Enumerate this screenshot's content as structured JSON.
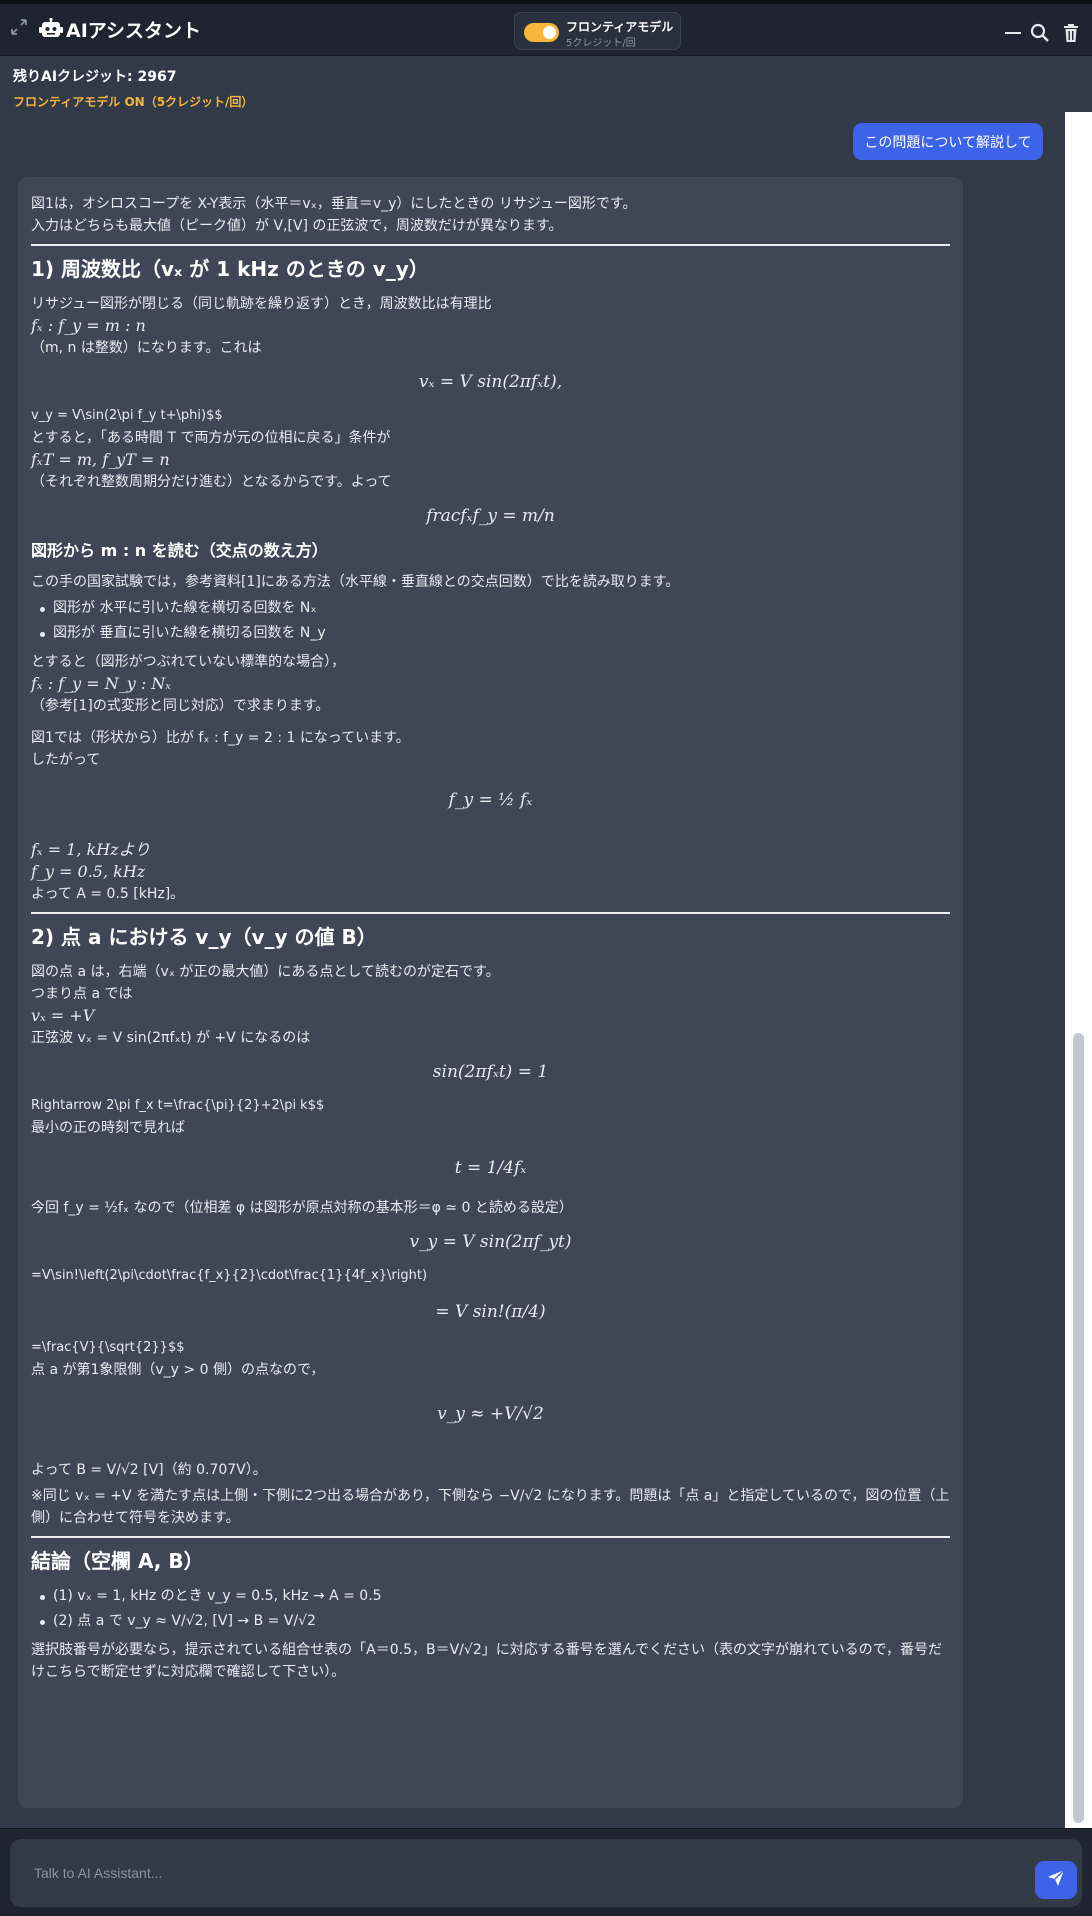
{
  "header": {
    "title": "AIアシスタント",
    "model_toggle": {
      "title": "フロンティアモデル",
      "subtitle": "5クレジット/回",
      "enabled": true,
      "accent": "#f5b63a"
    },
    "icons": [
      "expand-icon",
      "robot-icon",
      "minimize-icon",
      "search-icon",
      "trash-icon"
    ]
  },
  "status": {
    "credits": "残りAIクレジット: 2967",
    "frontier": "フロンティアモデル ON（5クレジット/回）"
  },
  "user_message": "この問題について解説して",
  "answer": {
    "intro1": "図1は，オシロスコープを X-Y表示（水平＝vₓ，垂直＝v_y）にしたときの リサジュー図形です。",
    "intro2": "入力はどちらも最大値（ピーク値）が V,[V] の正弦波で，周波数だけが異なります。",
    "s1_heading": "1) 周波数比（vₓ が 1 kHz のときの v_y）",
    "s1_l1": "リサジュー図形が閉じる（同じ軌跡を繰り返す）とき，周波数比は有理比",
    "s1_f1": "fₓ : f_y = m : n",
    "s1_l2": "（m, n は整数）になります。これは",
    "s1_d1": "vₓ = V sin(2πfₓt),",
    "s1_raw1": "v_y = V\\sin(2\\pi f_y t+\\phi)$$",
    "s1_l3": "とすると，「ある時間 T で両方が元の位相に戻る」条件が",
    "s1_f2": "fₓT = m,    f_yT = n",
    "s1_l4": "（それぞれ整数周期分だけ進む）となるからです。よって",
    "s1_d2": "fracfₓf_y = m/n",
    "s1_sub_heading": "図形から m : n を読む（交点の数え方）",
    "s1_l5": "この手の国家試験では，参考資料[1]にある方法（水平線・垂直線との交点回数）で比を読み取ります。",
    "s1_b1": "図形が 水平に引いた線を横切る回数を Nₓ",
    "s1_b2": "図形が 垂直に引いた線を横切る回数を N_y",
    "s1_l6": "とすると（図形がつぶれていない標準的な場合），",
    "s1_f3": "fₓ : f_y = N_y : Nₓ",
    "s1_l7": "（参考[1]の式変形と同じ対応）で求まります。",
    "s1_l8": "図1では（形状から）比が fₓ : f_y = 2 : 1 になっています。",
    "s1_l9": "したがって",
    "s1_d3": "f_y = ½ fₓ",
    "s1_f4": "fₓ = 1, kHzより",
    "s1_f5": "f_y = 0.5, kHz",
    "s1_result": "よって A = 0.5 [kHz]。",
    "s2_heading": "2) 点 a における v_y（v_y の値 B）",
    "s2_l1": "図の点 a は，右端（vₓ が正の最大値）にある点として読むのが定石です。",
    "s2_l2": "つまり点 a では",
    "s2_f1": "vₓ = +V",
    "s2_l3": "正弦波 vₓ = V sin(2πfₓt) が +V になるのは",
    "s2_d1": "sin(2πfₓt) = 1",
    "s2_raw1": "Rightarrow 2\\pi f_x t=\\frac{\\pi}{2}+2\\pi k$$",
    "s2_l4": "最小の正の時刻で見れば",
    "s2_d2": "t = 1/4fₓ",
    "s2_l5": "今回 f_y = ½fₓ なので（位相差 φ は図形が原点対称の基本形＝φ ≃ 0 と読める設定）",
    "s2_d3": "v_y = V sin(2πf_yt)",
    "s2_raw2": "=V\\sin!\\left(2\\pi\\cdot\\frac{f_x}{2}\\cdot\\frac{1}{4f_x}\\right)",
    "s2_d4": "= V sin!(π/4)",
    "s2_raw3": "=\\frac{V}{\\sqrt{2}}$$",
    "s2_l6": "点 a が第1象限側（v_y > 0 側）の点なので，",
    "s2_d5": "v_y ≈ +V/√2",
    "s2_result": "よって B = V/√2 [V]（約 0.707V）。",
    "s2_note": "※同じ vₓ = +V を満たす点は上側・下側に2つ出る場合があり，下側なら −V/√2 になります。問題は「点 a」と指定しているので，図の位置（上側）に合わせて符号を決めます。",
    "s3_heading": "結論（空欄 A, B）",
    "s3_b1": "(1) vₓ = 1, kHz のとき v_y = 0.5, kHz → A = 0.5",
    "s3_b2": "(2) 点 a で v_y ≈ V/√2, [V] → B = V/√2",
    "s3_l1": "選択肢番号が必要なら，提示されている組合せ表の「A＝0.5，B＝V/√2」に対応する番号を選んでください（表の文字が崩れているので，番号だけこちらで断定せずに対応欄で確認して下さい）。"
  },
  "chat": {
    "placeholder": "Talk to AI Assistant..."
  },
  "colors": {
    "background": "#323a4a",
    "card": "#3f4656",
    "accent_blue": "#3d63e8",
    "accent_amber": "#f5b63a"
  }
}
